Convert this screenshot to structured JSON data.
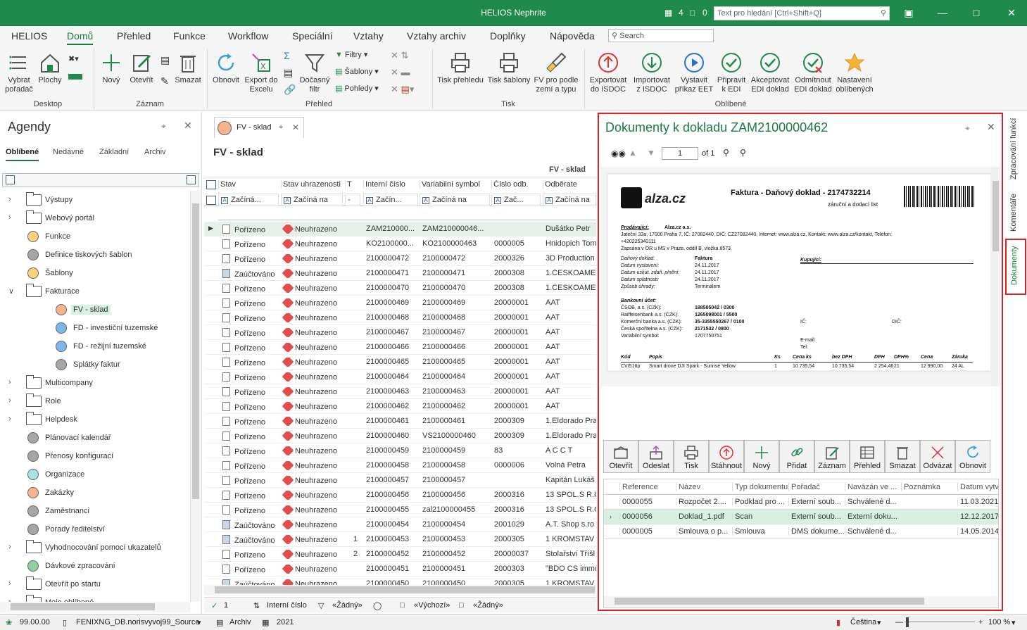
{
  "app": {
    "title": "HELIOS Nephrite",
    "msg_count": "4",
    "chat_count": "0",
    "search_placeholder": "Text pro hledání [Ctrl+Shift+Q]"
  },
  "menu": {
    "items": [
      "HELIOS",
      "Domů",
      "Přehled",
      "Funkce",
      "Workflow",
      "Speciální",
      "Vztahy",
      "Vztahy archiv",
      "Doplňky",
      "Nápověda"
    ],
    "search_label": "Search"
  },
  "ribbon": {
    "desktop": {
      "label": "Desktop",
      "vybrat": "Vybrat",
      "poradac": "pořadač",
      "plochy": "Plochy"
    },
    "zaznam": {
      "label": "Záznam",
      "novy": "Nový",
      "otevrit": "Otevřít",
      "smazat": "Smazat"
    },
    "prehled": {
      "label": "Přehled",
      "obnovit": "Obnovit",
      "export1": "Export do",
      "export2": "Excelu",
      "docasny1": "Dočasný",
      "docasny2": "filtr",
      "filtry": "Filtry",
      "sablony": "Šablony",
      "pohledy": "Pohledy"
    },
    "tisk": {
      "label": "Tisk",
      "tisk_prehledu": "Tisk přehledu",
      "tisk_sablony": "Tisk šablony",
      "fv1": "FV pro podle",
      "fv2": "zemí a typu"
    },
    "oblibene": {
      "label": "Oblíbené",
      "buttons": [
        {
          "l1": "Exportovat",
          "l2": "do ISDOC"
        },
        {
          "l1": "Importovat",
          "l2": "z ISDOC"
        },
        {
          "l1": "Vystavit",
          "l2": "příkaz EET"
        },
        {
          "l1": "Připravit",
          "l2": "k EDI"
        },
        {
          "l1": "Akceptovat",
          "l2": "EDI doklad"
        },
        {
          "l1": "Odmítnout",
          "l2": "EDI doklad"
        },
        {
          "l1": "Nastavení",
          "l2": "oblíbených"
        }
      ]
    }
  },
  "agendy": {
    "title": "Agendy",
    "tabs": [
      "Oblíbené",
      "Nedávné",
      "Základní",
      "Archiv"
    ],
    "items": [
      {
        "label": "Výstupy",
        "kind": "folder",
        "level": 0,
        "exp": "right"
      },
      {
        "label": "Webový portál",
        "kind": "folder",
        "level": 0,
        "exp": "right"
      },
      {
        "label": "Funkce",
        "kind": "dot",
        "color": "#f8d37a",
        "level": 0
      },
      {
        "label": "Definice tiskových šablon",
        "kind": "dot",
        "color": "#a6a6a6",
        "level": 0
      },
      {
        "label": "Šablony",
        "kind": "dot",
        "color": "#f8d37a",
        "level": 0
      },
      {
        "label": "Fakturace",
        "kind": "folder",
        "level": 0,
        "exp": "down"
      },
      {
        "label": "FV - sklad",
        "kind": "dot",
        "color": "#f6b48d",
        "level": 1,
        "selected": true
      },
      {
        "label": "FD - investiční tuzemské",
        "kind": "dot",
        "color": "#7bb6ee",
        "level": 1
      },
      {
        "label": "FD - režijní tuzemské",
        "kind": "dot",
        "color": "#7bb6ee",
        "level": 1
      },
      {
        "label": "Splátky faktur",
        "kind": "dot",
        "color": "#a6a6a6",
        "level": 1
      },
      {
        "label": "Multicompany",
        "kind": "folder",
        "level": 0,
        "exp": "right"
      },
      {
        "label": "Role",
        "kind": "folder",
        "level": 0,
        "exp": "right"
      },
      {
        "label": "Helpdesk",
        "kind": "folder",
        "level": 0,
        "exp": "right"
      },
      {
        "label": "Plánovací kalendář",
        "kind": "dot",
        "color": "#a6a6a6",
        "level": 0
      },
      {
        "label": "Přenosy konfigurací",
        "kind": "dot",
        "color": "#a6a6a6",
        "level": 0
      },
      {
        "label": "Organizace",
        "kind": "dot",
        "color": "#a8e2e2",
        "level": 0
      },
      {
        "label": "Zakázky",
        "kind": "dot",
        "color": "#f6b48d",
        "level": 0
      },
      {
        "label": "Zaměstnanci",
        "kind": "dot",
        "color": "#a6a6a6",
        "level": 0
      },
      {
        "label": "Porady ředitelství",
        "kind": "dot",
        "color": "#a6a6a6",
        "level": 0
      },
      {
        "label": "Vyhodnocování pomocí ukazatelů",
        "kind": "folder",
        "level": 0,
        "exp": "right"
      },
      {
        "label": "Dávkové zpracování",
        "kind": "dot",
        "color": "#8fd19c",
        "level": 0
      },
      {
        "label": "Otevřít po startu",
        "kind": "folder",
        "level": 0,
        "exp": "right"
      },
      {
        "label": "Moje oblíbené",
        "kind": "folder",
        "level": 0,
        "exp": "right"
      }
    ]
  },
  "grid": {
    "tab_label": "FV - sklad",
    "title": "FV - sklad",
    "group_label": "FV - sklad",
    "columns": [
      "Stav",
      "Stav uhrazenosti",
      "T",
      "Interní číslo",
      "Variabilní symbol",
      "Číslo odb.",
      "Odběrate"
    ],
    "filters": [
      "Začíná...",
      "Začíná na",
      "-",
      "Začín...",
      "Začíná na",
      "Zač...",
      "Začíná na"
    ],
    "rows": [
      {
        "stav": "Pořízeno",
        "uhr": "Neuhrazeno",
        "t": "",
        "int": "ZAM210000...",
        "var": "ZAM210000046...",
        "odb": "",
        "name": "Dušátko Petr"
      },
      {
        "stav": "Pořízeno",
        "uhr": "Neuhrazeno",
        "t": "",
        "int": "KO2100000...",
        "var": "KO2100000463",
        "odb": "0000005",
        "name": "Hnidopich Tom"
      },
      {
        "stav": "Pořízeno",
        "uhr": "Neuhrazeno",
        "t": "",
        "int": "2100000472",
        "var": "2100000472",
        "odb": "2000326",
        "name": "3D Production"
      },
      {
        "stav": "Zaúčtováno",
        "uhr": "Neuhrazeno",
        "t": "",
        "int": "2100000471",
        "var": "2100000471",
        "odb": "2000308",
        "name": "1.ČESKOAMER"
      },
      {
        "stav": "Pořízeno",
        "uhr": "Neuhrazeno",
        "t": "",
        "int": "2100000470",
        "var": "2100000470",
        "odb": "2000308",
        "name": "1.ČESKOAMER"
      },
      {
        "stav": "Pořízeno",
        "uhr": "Neuhrazeno",
        "t": "",
        "int": "2100000469",
        "var": "2100000469",
        "odb": "20000001",
        "name": "AAT"
      },
      {
        "stav": "Pořízeno",
        "uhr": "Neuhrazeno",
        "t": "",
        "int": "2100000468",
        "var": "2100000468",
        "odb": "20000001",
        "name": "AAT"
      },
      {
        "stav": "Pořízeno",
        "uhr": "Neuhrazeno",
        "t": "",
        "int": "2100000467",
        "var": "2100000467",
        "odb": "20000001",
        "name": "AAT"
      },
      {
        "stav": "Pořízeno",
        "uhr": "Neuhrazeno",
        "t": "",
        "int": "2100000466",
        "var": "2100000466",
        "odb": "20000001",
        "name": "AAT"
      },
      {
        "stav": "Pořízeno",
        "uhr": "Neuhrazeno",
        "t": "",
        "int": "2100000465",
        "var": "2100000465",
        "odb": "20000001",
        "name": "AAT"
      },
      {
        "stav": "Pořízeno",
        "uhr": "Neuhrazeno",
        "t": "",
        "int": "2100000464",
        "var": "2100000464",
        "odb": "20000001",
        "name": "AAT"
      },
      {
        "stav": "Pořízeno",
        "uhr": "Neuhrazeno",
        "t": "",
        "int": "2100000463",
        "var": "2100000463",
        "odb": "20000001",
        "name": "AAT"
      },
      {
        "stav": "Pořízeno",
        "uhr": "Neuhrazeno",
        "t": "",
        "int": "2100000462",
        "var": "2100000462",
        "odb": "20000001",
        "name": "AAT"
      },
      {
        "stav": "Pořízeno",
        "uhr": "Neuhrazeno",
        "t": "",
        "int": "2100000461",
        "var": "2100000461",
        "odb": "2000309",
        "name": "1.Eldorado Pra"
      },
      {
        "stav": "Pořízeno",
        "uhr": "Neuhrazeno",
        "t": "",
        "int": "2100000460",
        "var": "VS2100000460",
        "odb": "2000309",
        "name": "1.Eldorado Pra"
      },
      {
        "stav": "Pořízeno",
        "uhr": "Neuhrazeno",
        "t": "",
        "int": "2100000459",
        "var": "2100000459",
        "odb": "83",
        "name": "A C C T"
      },
      {
        "stav": "Pořízeno",
        "uhr": "Neuhrazeno",
        "t": "",
        "int": "2100000458",
        "var": "2100000458",
        "odb": "0000006",
        "name": "Volná Petra"
      },
      {
        "stav": "Pořízeno",
        "uhr": "Neuhrazeno",
        "t": "",
        "int": "2100000457",
        "var": "2100000457",
        "odb": "",
        "name": "Kapitán Lukáš"
      },
      {
        "stav": "Pořízeno",
        "uhr": "Neuhrazeno",
        "t": "",
        "int": "2100000456",
        "var": "2100000456",
        "odb": "2000316",
        "name": "13 SPOL.S R.O"
      },
      {
        "stav": "Pořízeno",
        "uhr": "Neuhrazeno",
        "t": "",
        "int": "2100000455",
        "var": "zal2100000455",
        "odb": "2000316",
        "name": "13 SPOL.S R.O"
      },
      {
        "stav": "Zaúčtováno",
        "uhr": "Neuhrazeno",
        "t": "",
        "int": "2100000454",
        "var": "2100000454",
        "odb": "2001029",
        "name": "A.T. Shop s.ro"
      },
      {
        "stav": "Zaúčtováno",
        "uhr": "Neuhrazeno",
        "t": "1",
        "int": "2100000453",
        "var": "2100000453",
        "odb": "2000305",
        "name": "1 KROMSTAV"
      },
      {
        "stav": "Pořízeno",
        "uhr": "Neuhrazeno",
        "t": "2",
        "int": "2100000452",
        "var": "2100000452",
        "odb": "20000037",
        "name": "Stolařství Tříšl"
      },
      {
        "stav": "Pořízeno",
        "uhr": "Neuhrazeno",
        "t": "",
        "int": "2100000451",
        "var": "2100000451",
        "odb": "2000303",
        "name": "\"BDO CS immo"
      },
      {
        "stav": "Zaúčtováno",
        "uhr": "Neuhrazeno",
        "t": "",
        "int": "2100000450",
        "var": "2100000450",
        "odb": "2000305",
        "name": "1 KROMSTAV"
      }
    ],
    "status": {
      "count": "1",
      "sort": "Interní číslo",
      "filter": "«Žádný»",
      "view": "«Výchozí»",
      "other": "«Žádný»"
    }
  },
  "docpane": {
    "title": "Dokumenty k dokladu ZAM2100000462",
    "page": "1",
    "of": "of 1",
    "pdf": {
      "logo": "alza.cz",
      "heading": "Faktura - Daňový doklad - 2174732214",
      "subheading": "záruční a dodací list",
      "seller_label": "Prodávající:",
      "seller_name": "Alza.cz a.s.",
      "seller_addr": "Jateční 33a, 17000 Praha 7, IČ: 27082440, DIČ: CZ27082440, Internet: www.alza.cz, Kontakt: www.alza.cz/kontakt, Telefon:",
      "seller_phone": "+420225340111",
      "seller_reg": "Zapsána v OR u MS v Praze, oddíl B, vložka 8573.",
      "buyer_label": "Kupující:",
      "fields": [
        {
          "k": "Daňový doklad:",
          "v": "Faktura"
        },
        {
          "k": "Datum vystavení:",
          "v": "24.11.2017"
        },
        {
          "k": "Datum uskut. zdaň. plnění:",
          "v": "24.11.2017"
        },
        {
          "k": "Datum splatnosti:",
          "v": "24.11.2017"
        },
        {
          "k": "Způsob úhrady:",
          "v": "Terminálem"
        }
      ],
      "bank_label": "Bankovní účet:",
      "banks": [
        {
          "k": "ČSOB, a.s. (CZK):",
          "v": "188505042 / 0300"
        },
        {
          "k": "Raiffeisenbank a.s. (CZK):",
          "v": "1265098001 / 5500"
        },
        {
          "k": "Komerční banka a.s. (CZK):",
          "v": "35-3355550267 / 0100"
        },
        {
          "k": "Česká spořitelna a.s. (CZK):",
          "v": "2171532 / 0800"
        },
        {
          "k": "Variabilní symbol:",
          "v": "1707750751"
        }
      ],
      "ic": "IČ:",
      "dic": "DIČ:",
      "email": "E-mail:",
      "tel": "Tel:",
      "table_headers": [
        "Kód",
        "Popis",
        "Ks",
        "Cena ks",
        "bez DPH",
        "DPH",
        "DPH%",
        "Cena",
        "Záruka"
      ],
      "table_row": [
        "CVI516p",
        "Smart drone DJI Spark - Sunrise Yellow",
        "1",
        "10 735,54",
        "10 735,54",
        "2 254,46",
        "21",
        "12 990,00",
        "24 AL"
      ],
      "row_suffix": "4"
    },
    "buttons": [
      "Otevřít",
      "Odeslat",
      "Tisk",
      "Stáhnout",
      "Nový",
      "Přidat",
      "Záznam",
      "Přehled",
      "Smazat",
      "Odvázat",
      "Obnovit"
    ],
    "table": {
      "columns": [
        "Reference",
        "Název",
        "Typ dokumentu",
        "Pořadač",
        "Navázán ve ...",
        "Poznámka",
        "Datum vytv"
      ],
      "rows": [
        {
          "ref": "0000055",
          "name": "Rozpočet 2....",
          "typ": "Podklad pro ...",
          "por": "Externí soub...",
          "naz": "Schválené d...",
          "pozn": "",
          "date": "11.03.2021"
        },
        {
          "ref": "0000056",
          "name": "Doklad_1.pdf",
          "typ": "Scan",
          "por": "Externí soub...",
          "naz": "Externí doku...",
          "pozn": "",
          "date": "12.12.2017"
        },
        {
          "ref": "0000005",
          "name": "Smlouva o p...",
          "typ": "Smlouva",
          "por": "DMS dokume...",
          "naz": "Schválené d...",
          "pozn": "",
          "date": "14.05.2014"
        }
      ]
    }
  },
  "right_tabs": [
    "Zpracování funkcí",
    "Komentáře",
    "Dokumenty"
  ],
  "statusbar": {
    "version": "99.00.00",
    "db": "FENIXNG_DB.norisvyvoj99_Source",
    "archiv": "Archiv",
    "year": "2021",
    "lang": "Čeština",
    "zoom": "100 %"
  },
  "colors": {
    "accent": "#1f8a4c",
    "highlight": "#d22222"
  }
}
